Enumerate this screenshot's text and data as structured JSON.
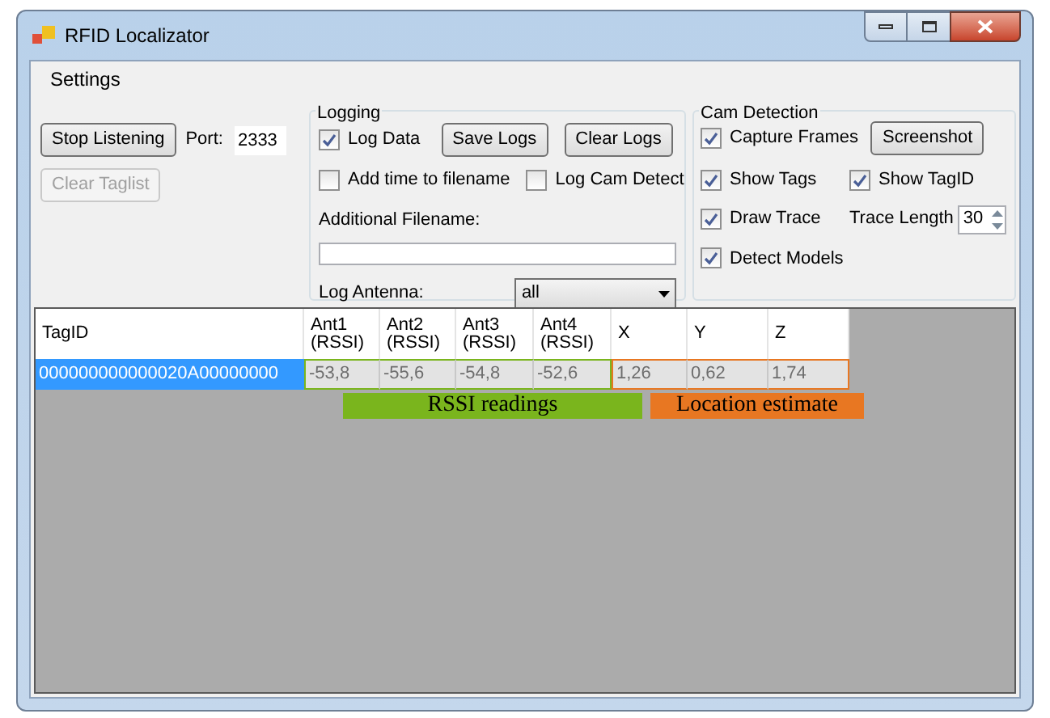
{
  "window": {
    "title": "RFID Localizator"
  },
  "menu": [
    {
      "label": "Settings"
    }
  ],
  "listening": {
    "stop_button": "Stop Listening",
    "port_label": "Port:",
    "port_value": "2333",
    "clear_button": {
      "label": "Clear Taglist",
      "disabled": true
    }
  },
  "logging": {
    "title": "Logging",
    "log_data": {
      "label": "Log Data",
      "checked": true
    },
    "save_button": "Save Logs",
    "clear_button": "Clear Logs",
    "add_time": {
      "label": "Add time to filename",
      "checked": false
    },
    "log_cam": {
      "label": "Log Cam Detect",
      "checked": false
    },
    "filename_label": "Additional Filename:",
    "antenna_label": "Log Antenna:",
    "antenna_value": "all"
  },
  "cam_detection": {
    "title": "Cam Detection",
    "capture_frames": {
      "label": "Capture Frames",
      "checked": true
    },
    "screenshot_button": "Screenshot",
    "show_tags": {
      "label": "Show Tags",
      "checked": true
    },
    "show_tagid": {
      "label": "Show TagID",
      "checked": true
    },
    "draw_trace": {
      "label": "Draw Trace",
      "checked": true
    },
    "trace_length_label": "Trace Length",
    "trace_length_value": "30",
    "detect_models": {
      "label": "Detect Models",
      "checked": true
    }
  },
  "table": {
    "columns": [
      {
        "label": "TagID",
        "kind": "id"
      },
      {
        "label": "Ant1",
        "sub": "(RSSI)",
        "kind": "rssi"
      },
      {
        "label": "Ant2",
        "sub": "(RSSI)",
        "kind": "rssi"
      },
      {
        "label": "Ant3",
        "sub": "(RSSI)",
        "kind": "rssi"
      },
      {
        "label": "Ant4",
        "sub": "(RSSI)",
        "kind": "rssi"
      },
      {
        "label": "X",
        "kind": "location"
      },
      {
        "label": "Y",
        "kind": "location"
      },
      {
        "label": "Z",
        "kind": "location"
      }
    ],
    "rows": [
      {
        "selected": true,
        "cells": [
          "000000000000020A00000000",
          "-53,8",
          "-55,6",
          "-54,8",
          "-52,6",
          "1,26",
          "0,62",
          "1,74"
        ]
      }
    ]
  },
  "annotations": [
    {
      "label": "RSSI readings",
      "kind": "rssi",
      "color": "#7ab51d"
    },
    {
      "label": "Location estimate",
      "kind": "location",
      "color": "#e87722"
    }
  ]
}
